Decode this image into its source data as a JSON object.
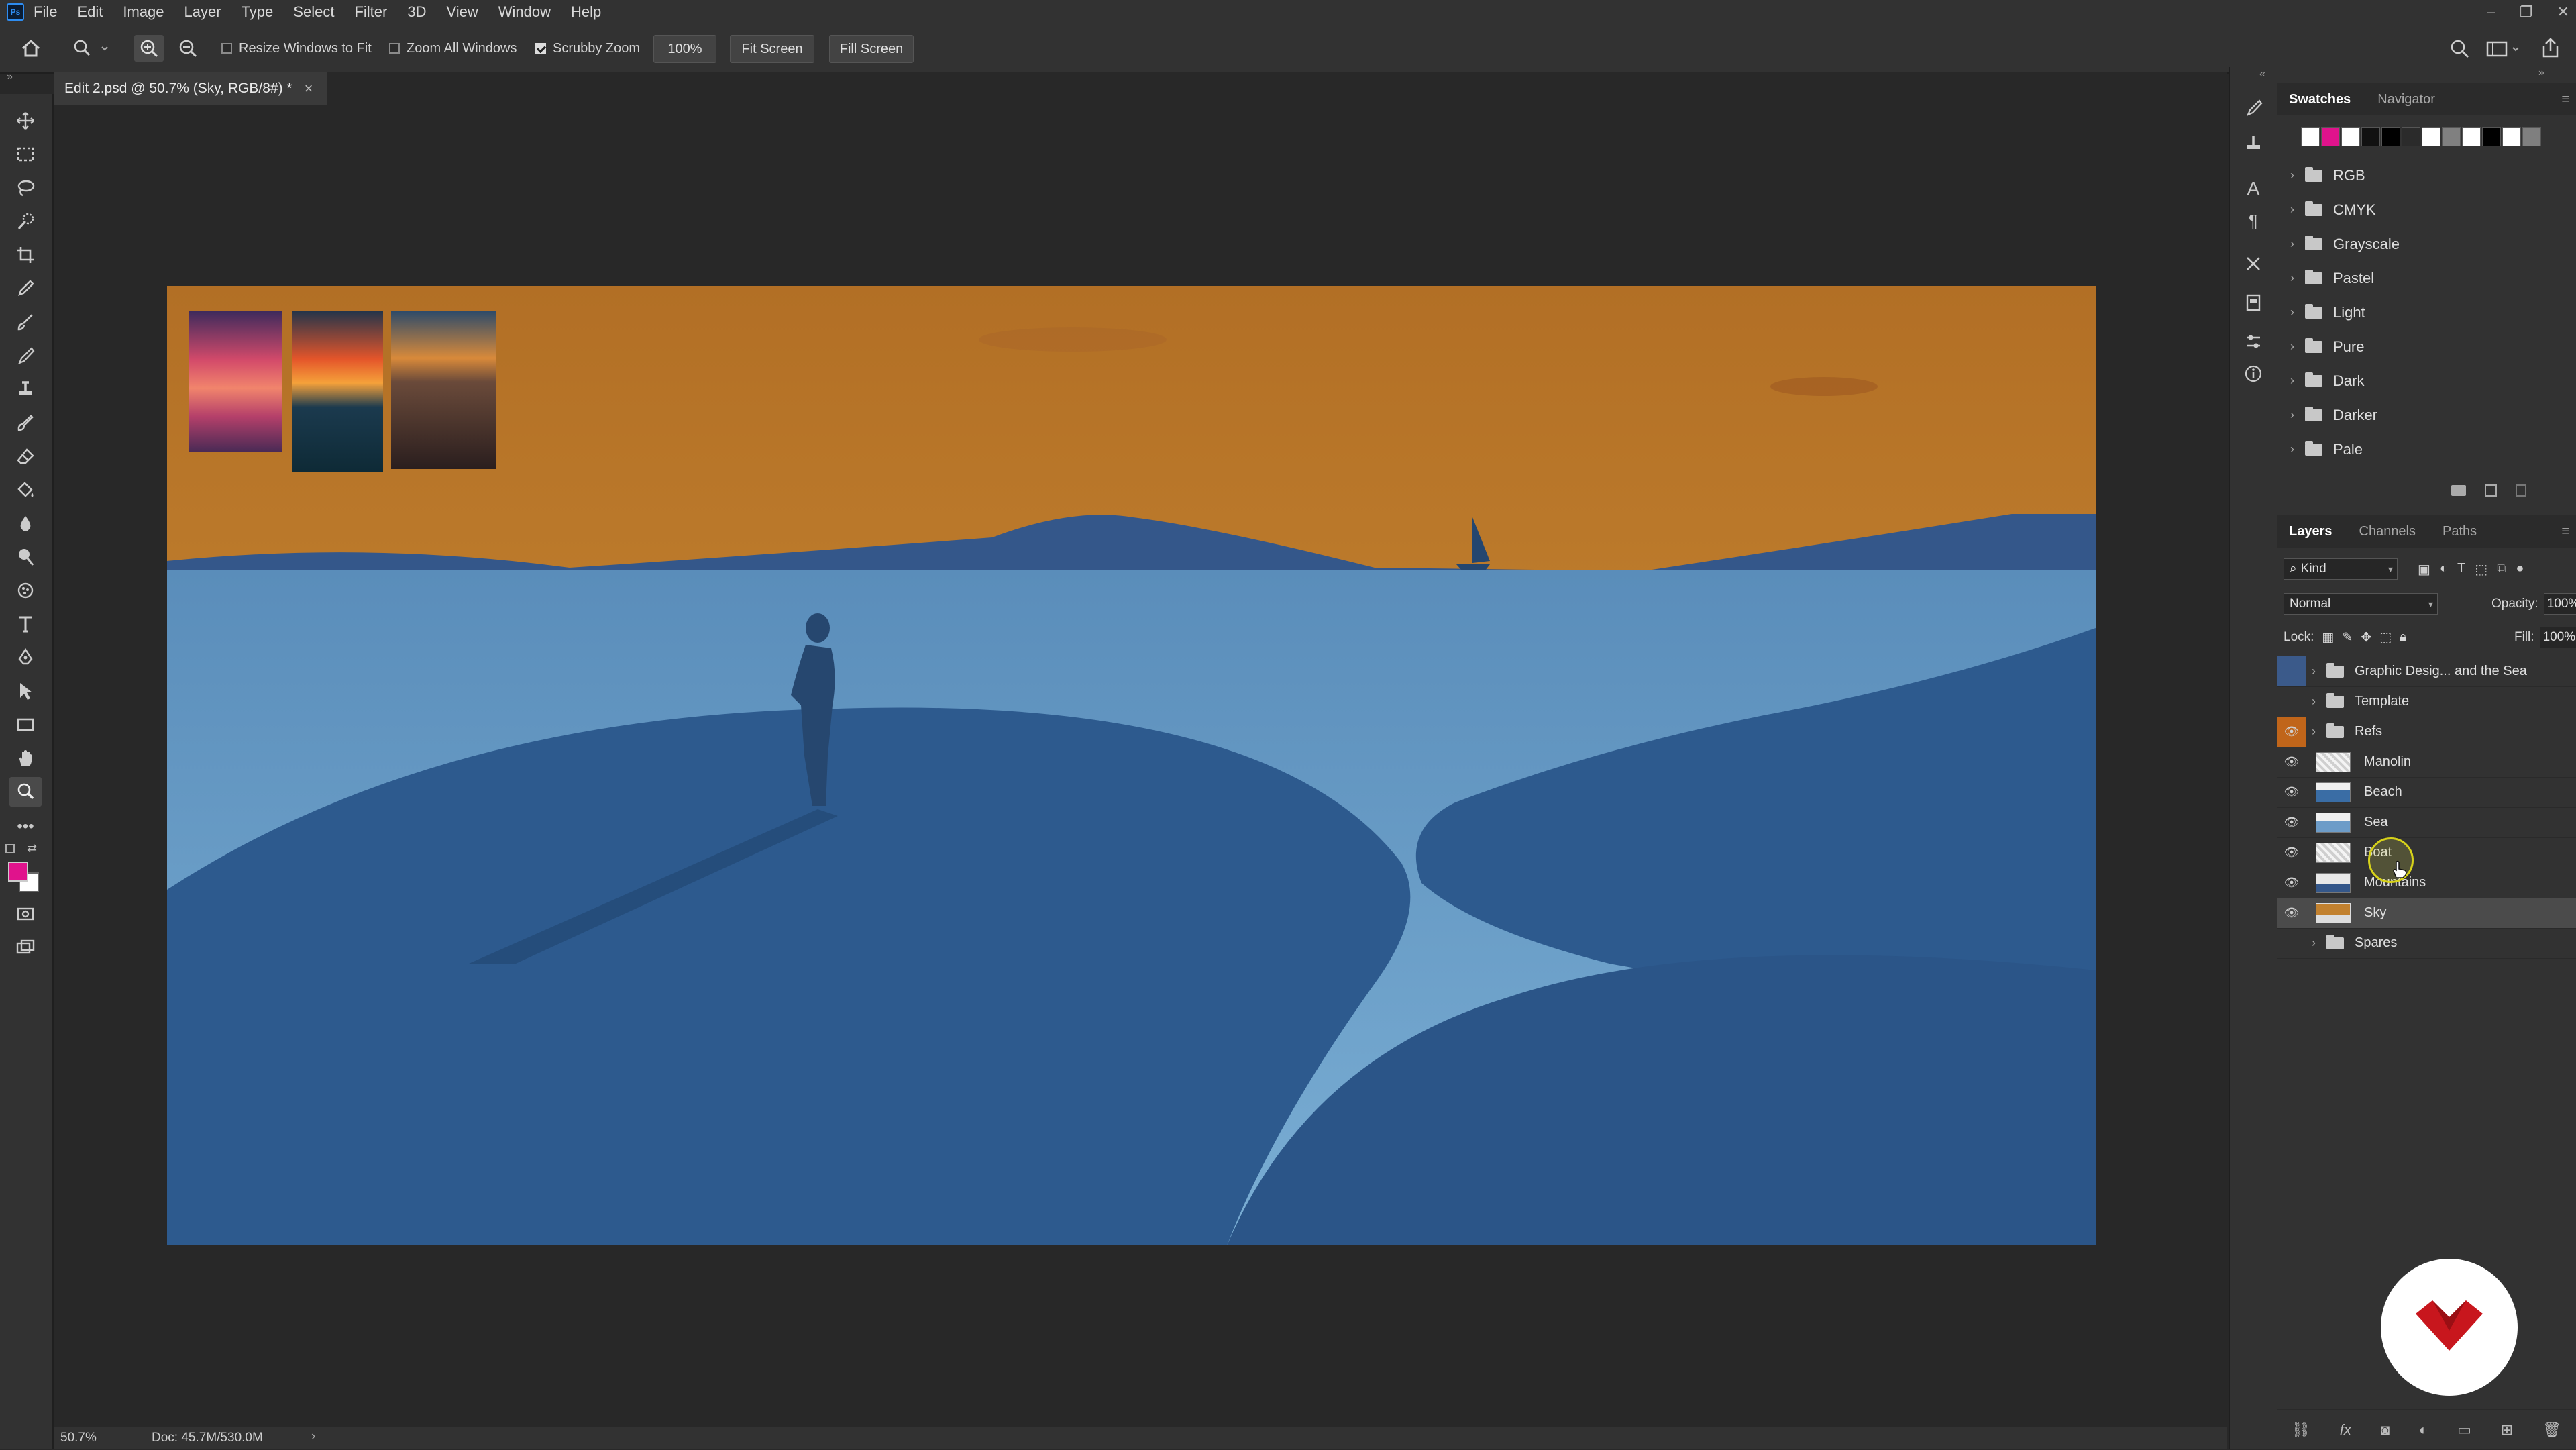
{
  "menu": [
    "File",
    "Edit",
    "Image",
    "Layer",
    "Type",
    "Select",
    "Filter",
    "3D",
    "View",
    "Window",
    "Help"
  ],
  "window_controls": {
    "minimize": "–",
    "restore": "❐",
    "close": "✕"
  },
  "options": {
    "resize_windows": {
      "label": "Resize Windows to Fit",
      "checked": false
    },
    "zoom_all": {
      "label": "Zoom All Windows",
      "checked": false
    },
    "scrubby": {
      "label": "Scrubby Zoom",
      "checked": true
    },
    "zoom_value": "100%",
    "fit_screen": "Fit Screen",
    "fill_screen": "Fill Screen"
  },
  "document_tab": {
    "title": "Edit 2.psd @ 50.7% (Sky, RGB/8#) *",
    "close": "×"
  },
  "status": {
    "zoom": "50.7%",
    "doc": "Doc: 45.7M/530.0M",
    "arrow": "›"
  },
  "swatches_panel": {
    "tabs": [
      "Swatches",
      "Navigator"
    ],
    "colors": [
      "#ffffff",
      "#e0138c",
      "#ffffff",
      "#111111",
      "#000000",
      "#2b2b2b",
      "#ffffff",
      "#808080",
      "#ffffff",
      "#000000",
      "#ffffff",
      "#7f7f7f"
    ],
    "groups": [
      "RGB",
      "CMYK",
      "Grayscale",
      "Pastel",
      "Light",
      "Pure",
      "Dark",
      "Darker",
      "Pale"
    ]
  },
  "layers_panel": {
    "tabs": [
      "Layers",
      "Channels",
      "Paths"
    ],
    "filter": "Kind",
    "blend_mode": "Normal",
    "opacity_label": "Opacity:",
    "opacity": "100%",
    "lock_label": "Lock:",
    "fill_label": "Fill:",
    "fill": "100%",
    "layers": [
      {
        "name": "Graphic Desig... and the Sea",
        "type": "group",
        "visible": false
      },
      {
        "name": "Template",
        "type": "group",
        "visible": false
      },
      {
        "name": "Refs",
        "type": "group",
        "visible": true
      },
      {
        "name": "Manolin",
        "type": "layer",
        "visible": true
      },
      {
        "name": "Beach",
        "type": "layer",
        "visible": true
      },
      {
        "name": "Sea",
        "type": "layer",
        "visible": true
      },
      {
        "name": "Boat",
        "type": "layer",
        "visible": true
      },
      {
        "name": "Mountains",
        "type": "layer",
        "visible": true
      },
      {
        "name": "Sky",
        "type": "layer",
        "visible": true,
        "selected": true
      },
      {
        "name": "Spares",
        "type": "group",
        "visible": false
      }
    ]
  },
  "colors": {
    "foreground": "#e0138c",
    "background": "#ffffff",
    "accent": "#2e8cf0",
    "selected_layer": "#4b4b4b",
    "visibility_highlight": "#c0651a"
  }
}
